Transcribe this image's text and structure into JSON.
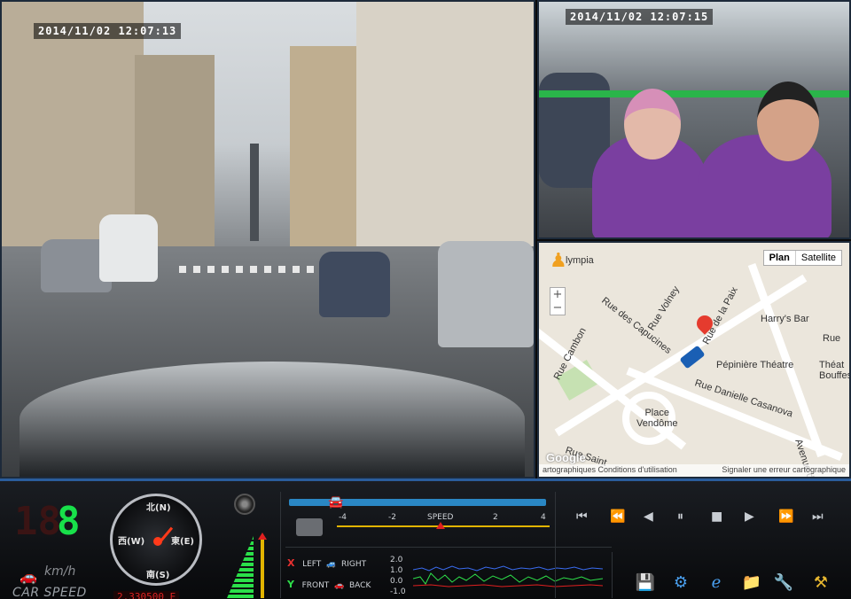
{
  "front_camera": {
    "timestamp": "2014/11/02  12:07:13"
  },
  "cabin_camera": {
    "timestamp": "2014/11/02  12:07:15"
  },
  "map": {
    "type_buttons": [
      "Plan",
      "Satellite"
    ],
    "zoom_in": "+",
    "zoom_out": "−",
    "labels": [
      "lympia",
      "Rue Volney",
      "Rue de la Paix",
      "Harry's Bar",
      "Rue des Capucines",
      "Rue Cambon",
      "Pépinière Théatre",
      "Rue Danielle Casanova",
      "Place\nVendôme",
      "Théat\nBouffes Pa",
      "Rue",
      "Avenue d",
      "Rue Saint"
    ],
    "logo": "Google",
    "footer_left": "artographiques  Conditions d'utilisation",
    "footer_right": "Signaler une erreur cartographique"
  },
  "dashboard": {
    "speed_digits_off": "18",
    "speed_digits_on": "8",
    "speed_unit": "km/h",
    "car_speed_label": "CAR SPEED",
    "compass": {
      "north": "北(N)",
      "south": "南(S)",
      "east": "東(E)",
      "west": "西(W)"
    },
    "coordinate": "2.330500 E",
    "speed_scale": {
      "label": "SPEED",
      "ticks": [
        "-4",
        "-2",
        "2",
        "4"
      ]
    },
    "gsensor": {
      "x_axis": "X",
      "left": "LEFT",
      "right": "RIGHT",
      "y_axis": "Y",
      "front": "FRONT",
      "back": "BACK",
      "ticks": [
        "2.0",
        "1.0",
        "0.0",
        "-1.0"
      ]
    },
    "playback": [
      "skip-back",
      "step-back",
      "rewind",
      "pause",
      "stop",
      "play",
      "step-forward",
      "skip-forward"
    ],
    "tools": [
      "save",
      "settings",
      "internet",
      "folder",
      "tools",
      "tool-settings"
    ]
  },
  "colors": {
    "accent": "#2a87c4",
    "speed_digit": "#18e04a",
    "warning": "#e02020"
  }
}
